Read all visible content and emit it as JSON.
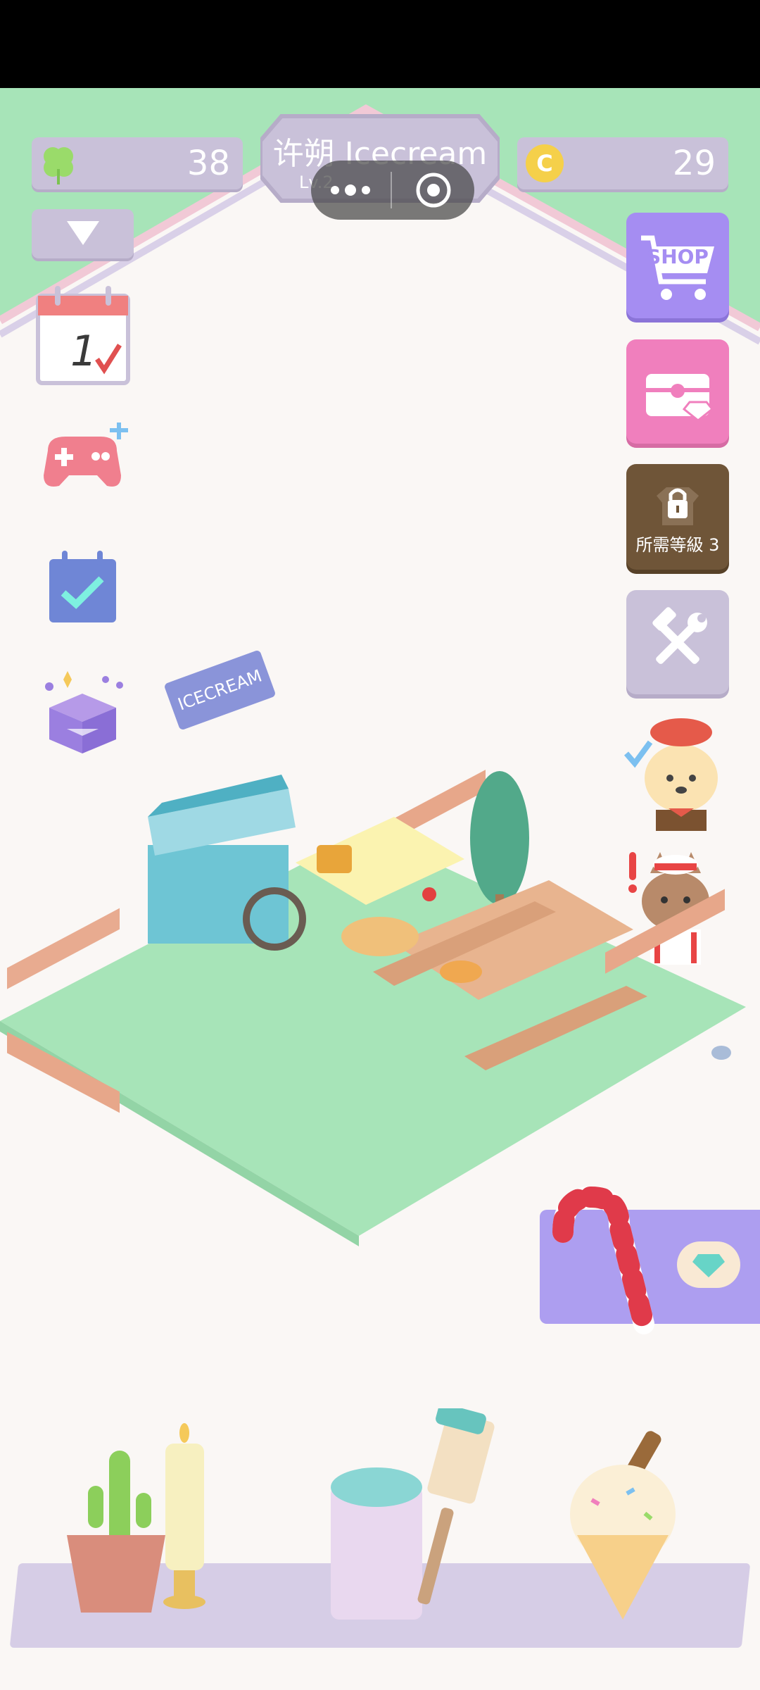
{
  "status": {
    "bg": "#000000"
  },
  "hud": {
    "clover_count": "38",
    "coin_count": "29",
    "title": "许朔 Icecream",
    "level": "Lv.2",
    "coin_symbol": "C"
  },
  "right_menu": {
    "shop_label": "SHOP",
    "locked_label": "所需等級 3"
  },
  "sign": {
    "text": "ICECREAM"
  },
  "calendar": {
    "day": "1"
  },
  "colors": {
    "grass": "#a7e4b8",
    "fence": "#e7a78a",
    "shop": "#a58df2",
    "gift": "#f07fbd",
    "locked": "#6f5538",
    "tools": "#c9c1d9",
    "promo": "#ad9ef0"
  }
}
